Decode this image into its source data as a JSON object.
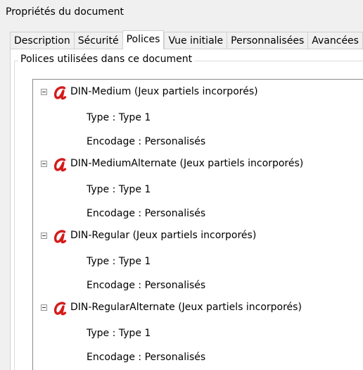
{
  "window": {
    "title": "Propriétés du document"
  },
  "tabs": [
    {
      "label": "Description"
    },
    {
      "label": "Sécurité"
    },
    {
      "label": "Polices"
    },
    {
      "label": "Vue initiale"
    },
    {
      "label": "Personnalisées"
    },
    {
      "label": "Avancées"
    }
  ],
  "active_tab": "Polices",
  "group": {
    "label": "Polices utilisées dans ce document"
  },
  "fonts": [
    {
      "name": "DIN-Medium (Jeux partiels incorporés)",
      "type": "Type : Type 1",
      "encoding": "Encodage : Personalisés"
    },
    {
      "name": "DIN-MediumAlternate (Jeux partiels incorporés)",
      "type": "Type : Type 1",
      "encoding": "Encodage : Personalisés"
    },
    {
      "name": "DIN-Regular (Jeux partiels incorporés)",
      "type": "Type : Type 1",
      "encoding": "Encodage : Personalisés"
    },
    {
      "name": "DIN-RegularAlternate (Jeux partiels incorporés)",
      "type": "Type : Type 1",
      "encoding": "Encodage : Personalisés"
    }
  ],
  "icons": {
    "font": "font-type-icon",
    "collapse": "collapse-icon"
  },
  "colors": {
    "font_icon": "#d41c1c"
  }
}
